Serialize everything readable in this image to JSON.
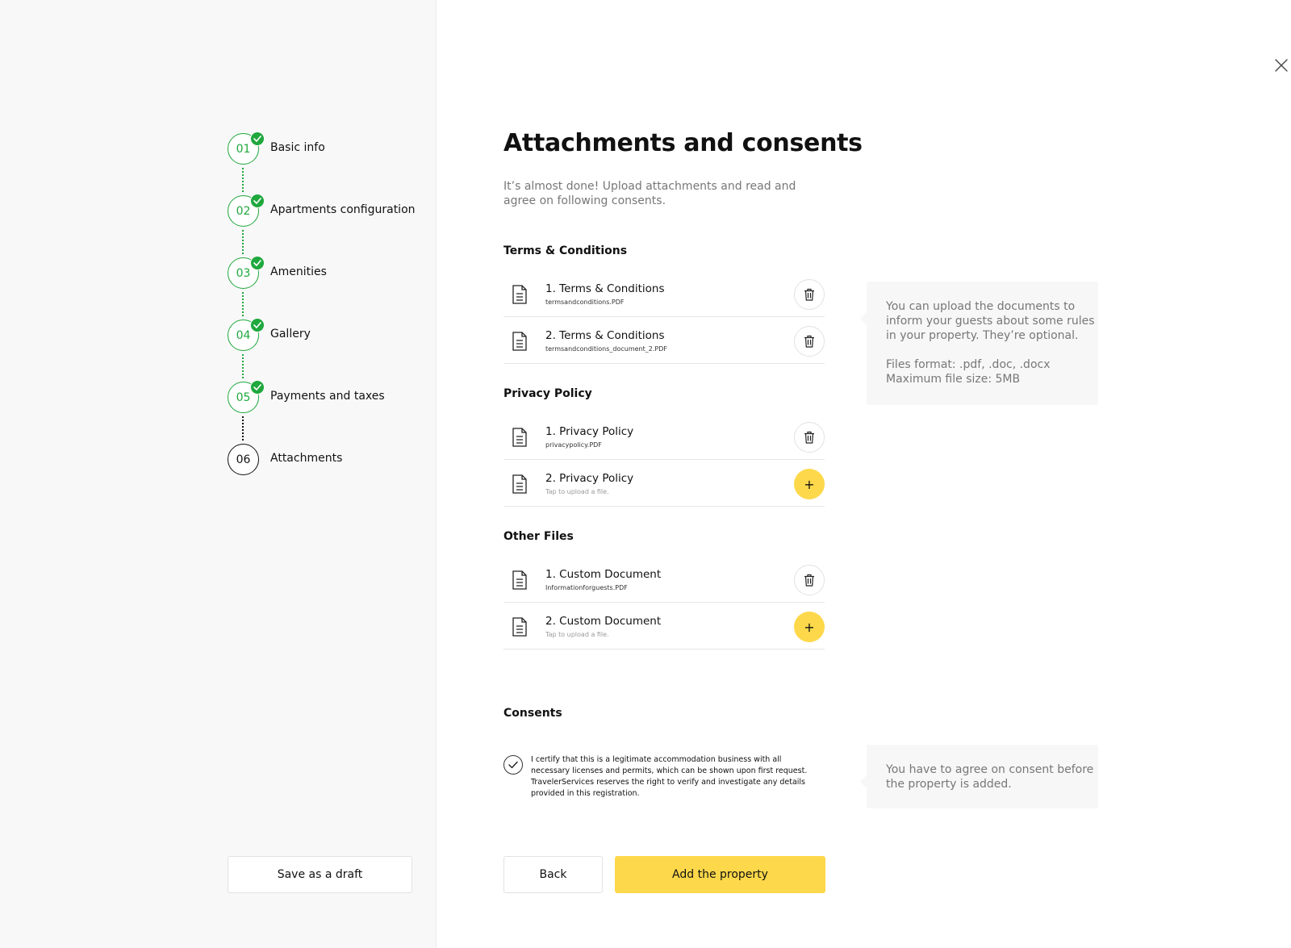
{
  "sidebar": {
    "steps": [
      {
        "num": "01",
        "label": "Basic info",
        "done": true
      },
      {
        "num": "02",
        "label": "Apartments configuration",
        "done": true
      },
      {
        "num": "03",
        "label": "Amenities",
        "done": true
      },
      {
        "num": "04",
        "label": "Gallery",
        "done": true
      },
      {
        "num": "05",
        "label": "Payments and taxes",
        "done": true
      },
      {
        "num": "06",
        "label": "Attachments",
        "done": false
      }
    ],
    "save_draft_label": "Save as a draft"
  },
  "main": {
    "title": "Attachments and consents",
    "subtitle": "It’s almost done! Upload attachments and read and agree on following consents.",
    "sections": {
      "terms": {
        "title": "Terms & Conditions",
        "files": [
          {
            "name": "1. Terms & Conditions",
            "sub": "termsandconditions.PDF",
            "uploaded": true
          },
          {
            "name": "2. Terms & Conditions",
            "sub": "termsandconditions_document_2.PDF",
            "uploaded": true
          }
        ]
      },
      "privacy": {
        "title": "Privacy Policy",
        "files": [
          {
            "name": "1. Privacy Policy",
            "sub": "privacypolicy.PDF",
            "uploaded": true
          },
          {
            "name": "2. Privacy Policy",
            "sub": "Tap to upload a file.",
            "uploaded": false
          }
        ]
      },
      "other": {
        "title": "Other Files",
        "files": [
          {
            "name": "1. Custom Document",
            "sub": "Informationforguests.PDF",
            "uploaded": true
          },
          {
            "name": "2. Custom Document",
            "sub": "Tap to upload a file.",
            "uploaded": false
          }
        ]
      }
    },
    "consents": {
      "title": "Consents",
      "checked": true,
      "text": "I certify that this is a legitimate accommodation business with all necessary licenses and permits, which can be shown upon first request. TravelerServices reserves the right to verify and investigate any details provided in this registration."
    },
    "buttons": {
      "back": "Back",
      "add_property": "Add the property",
      "add_symbol": "+"
    }
  },
  "info": {
    "upload_lines": [
      "You can upload the documents to",
      "inform your guests about some rules",
      "in your property. They’re optional."
    ],
    "format_lines": [
      "Files format: .pdf, .doc, .docx",
      "Maximum file size: 5MB"
    ],
    "consent_lines": [
      "You have to agree on consent before",
      "the property is added."
    ]
  },
  "colors": {
    "accent": "#fdd84a",
    "success": "#1fa83d",
    "sidebar_bg": "#f8f8f8",
    "muted_text": "#777777"
  },
  "icons": [
    "check-icon",
    "document-icon",
    "trash-icon",
    "plus-icon",
    "close-icon"
  ]
}
